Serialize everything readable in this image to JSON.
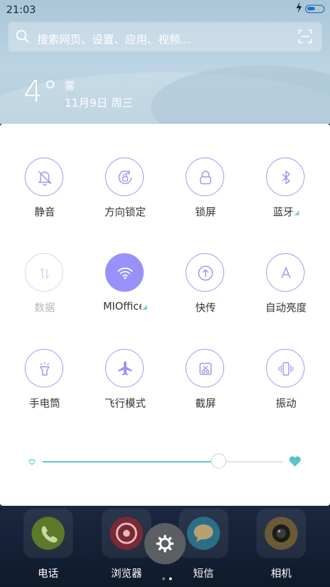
{
  "status_bar": {
    "time": "21:03",
    "battery_percent": 50
  },
  "search": {
    "placeholder": "搜索网页、设置、应用、视频..."
  },
  "weather": {
    "temperature": "4°",
    "condition": "雾",
    "date": "11月9日 周三"
  },
  "toggles": [
    {
      "label": "静音",
      "icon": "bell-off-icon",
      "state": "off"
    },
    {
      "label": "方向锁定",
      "icon": "rotation-lock-icon",
      "state": "off"
    },
    {
      "label": "锁屏",
      "icon": "lock-icon",
      "state": "off"
    },
    {
      "label": "蓝牙",
      "icon": "bluetooth-icon",
      "state": "off",
      "has_menu": true
    },
    {
      "label": "数据",
      "icon": "data-icon",
      "state": "disabled"
    },
    {
      "label": "MIOffice",
      "icon": "wifi-icon",
      "state": "on",
      "has_menu": true
    },
    {
      "label": "快传",
      "icon": "transfer-icon",
      "state": "off"
    },
    {
      "label": "自动亮度",
      "icon": "auto-brightness-icon",
      "state": "off"
    },
    {
      "label": "手电筒",
      "icon": "flashlight-icon",
      "state": "off"
    },
    {
      "label": "飞行模式",
      "icon": "airplane-icon",
      "state": "off"
    },
    {
      "label": "截屏",
      "icon": "screenshot-icon",
      "state": "off"
    },
    {
      "label": "振动",
      "icon": "vibrate-icon",
      "state": "off"
    }
  ],
  "brightness": {
    "level": 0.73
  },
  "dock": {
    "apps": [
      {
        "label": "电话",
        "icon": "phone-icon"
      },
      {
        "label": "浏览器",
        "icon": "browser-icon"
      },
      {
        "label": "短信",
        "icon": "messages-icon"
      },
      {
        "label": "相机",
        "icon": "camera-icon"
      }
    ],
    "pages": 2,
    "current_page": 2
  },
  "colors": {
    "accent": "#9892f8",
    "slider": "#57c5c8"
  }
}
